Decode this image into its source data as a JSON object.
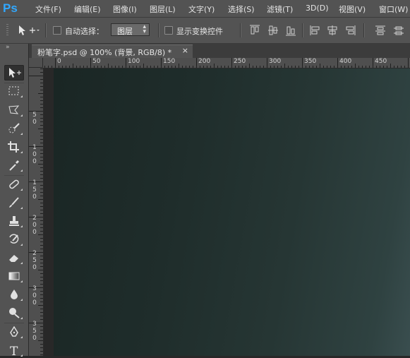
{
  "app": {
    "logo": "Ps"
  },
  "menu": [
    "文件(F)",
    "编辑(E)",
    "图像(I)",
    "图层(L)",
    "文字(Y)",
    "选择(S)",
    "滤镜(T)",
    "3D(D)",
    "视图(V)",
    "窗口(W)"
  ],
  "options": {
    "auto_select_label": "自动选择：",
    "auto_select_value": "图层",
    "show_transform_label": "显示变换控件"
  },
  "document_tab": {
    "title": "粉笔字.psd @ 100% (背景, RGB/8) *",
    "close": "×"
  },
  "ruler": {
    "horizontal": [
      "0",
      "50",
      "100",
      "150",
      "200",
      "250",
      "300",
      "350",
      "400",
      "450"
    ],
    "vertical": [
      [
        "5",
        "0"
      ],
      [
        "1",
        "0",
        "0"
      ],
      [
        "1",
        "5",
        "0"
      ],
      [
        "2",
        "0",
        "0"
      ],
      [
        "2",
        "5",
        "0"
      ],
      [
        "3",
        "0",
        "0"
      ],
      [
        "3",
        "5",
        "0"
      ]
    ]
  },
  "tools": [
    "move-tool",
    "marquee-tool",
    "lasso-tool",
    "quick-select-tool",
    "crop-tool",
    "eyedropper-tool",
    "healing-brush-tool",
    "brush-tool",
    "clone-stamp-tool",
    "history-brush-tool",
    "eraser-tool",
    "gradient-tool",
    "blur-tool",
    "dodge-tool",
    "pen-tool",
    "type-tool"
  ],
  "colors": {
    "canvas_start": "#1a2624",
    "canvas_end": "#3a4e4f",
    "panel": "#535353",
    "logo": "#31a8ff"
  }
}
